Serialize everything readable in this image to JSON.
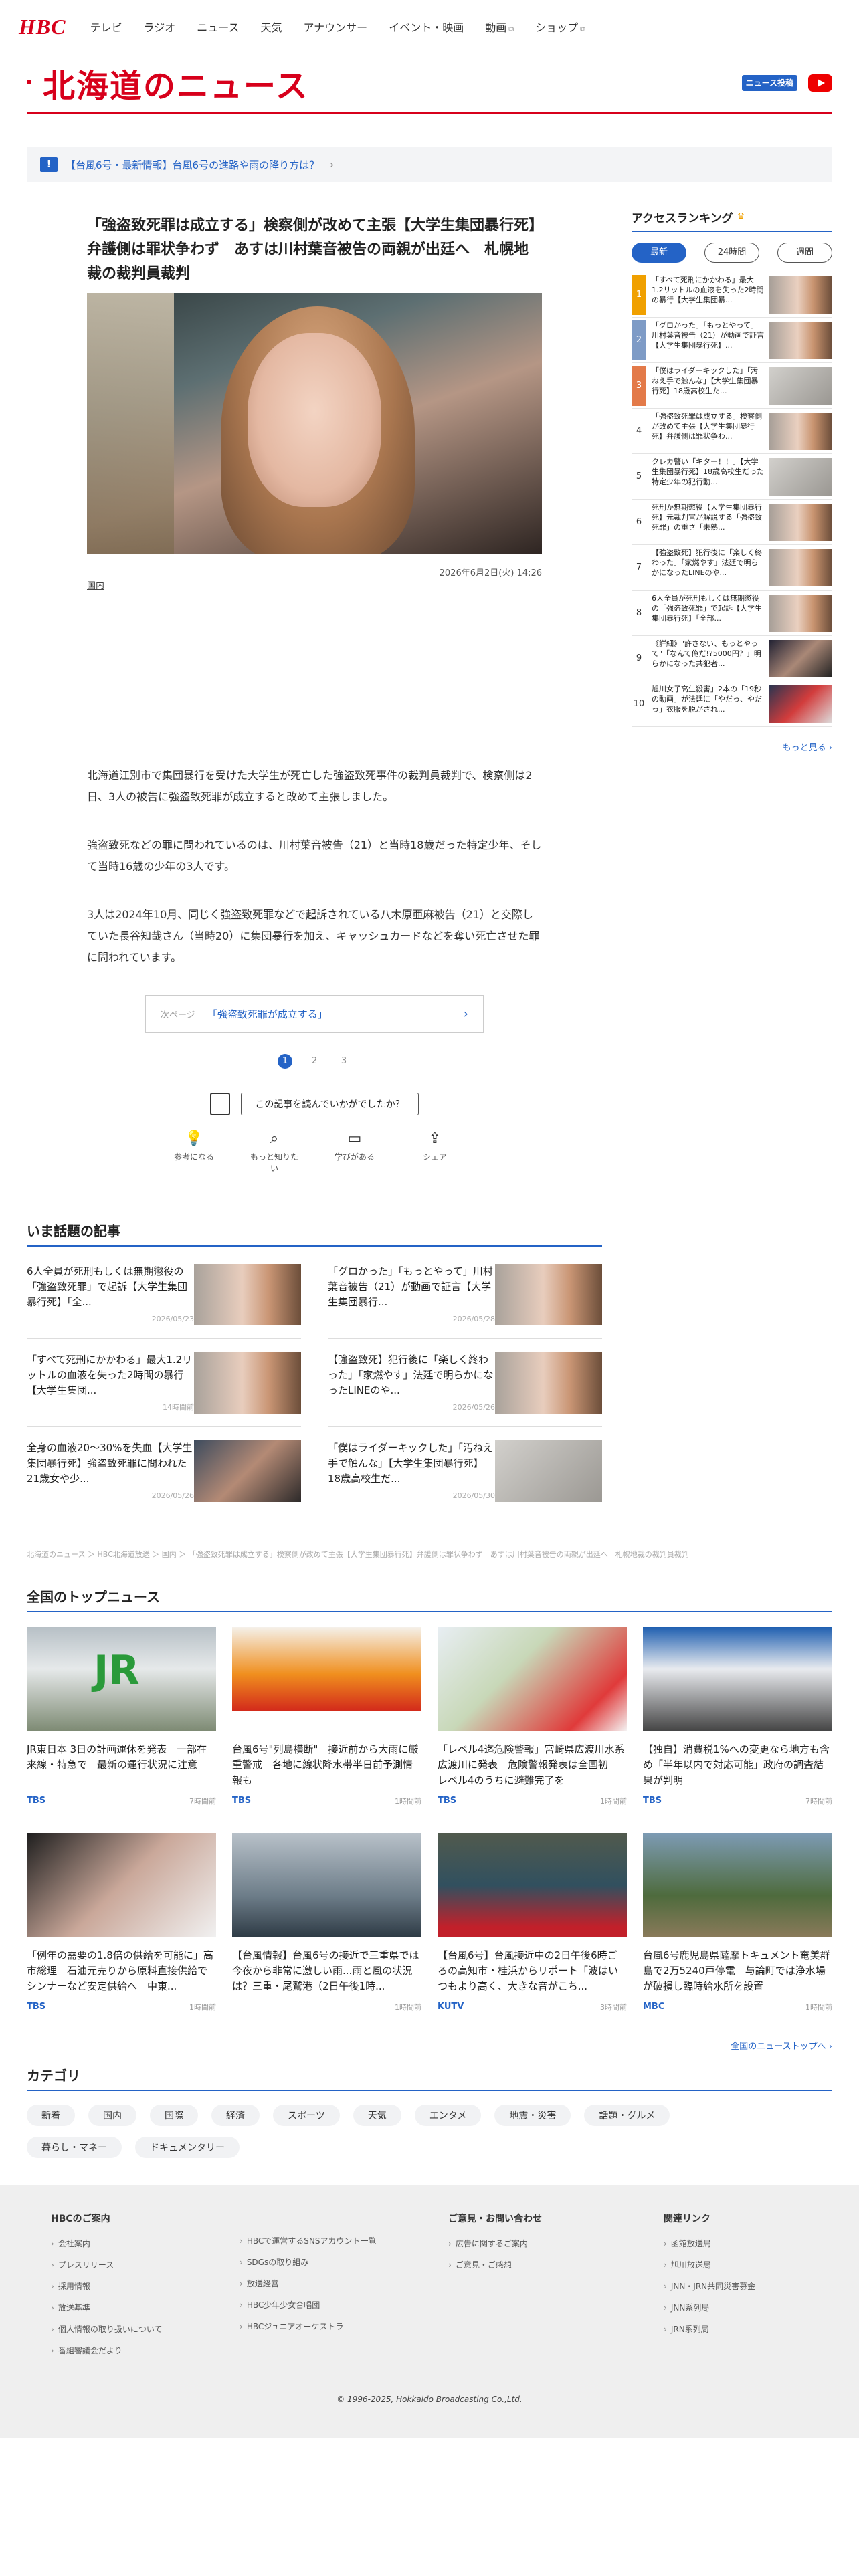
{
  "nav": {
    "logo": "HBC",
    "items": [
      "テレビ",
      "ラジオ",
      "ニュース",
      "天気",
      "アナウンサー",
      "イベント・映画",
      "動画",
      "ショップ"
    ]
  },
  "header": {
    "title": "北海道のニュース",
    "news_post": "ニュース投稿"
  },
  "alert": {
    "icon": "!",
    "text": "【台風6号・最新情報】台風6号の進路や雨の降り方は？"
  },
  "article": {
    "title": "「強盗致死罪は成立する」検察側が改めて主張【大学生集団暴行死】弁護側は罪状争わず　あすは川村葉音被告の両親が出廷へ　札幌地裁の裁判員裁判",
    "date": "2026年6月2日(火) 14:26",
    "category": "国内",
    "paragraphs": [
      "北海道江別市で集団暴行を受けた大学生が死亡した強盗致死事件の裁判員裁判で、検察側は2日、3人の被告に強盗致死罪が成立すると改めて主張しました。",
      "強盗致死などの罪に問われているのは、川村葉音被告（21）と当時18歳だった特定少年、そして当時16歳の少年の3人です。",
      "3人は2024年10月、同じく強盗致死罪などで起訴されている八木原亜麻被告（21）と交際していた長谷知哉さん（当時20）に集団暴行を加え、キャッシュカードなどを奪い死亡させた罪に問われています。"
    ],
    "next_label": "次ページ",
    "next_title": "「強盗致死罪が成立する」",
    "pages": [
      "1",
      "2",
      "3"
    ],
    "feedback_q": "この記事を読んでいかがでしたか？",
    "reactions": [
      "参考になる",
      "もっと知りたい",
      "学びがある",
      "シェア"
    ]
  },
  "ranking": {
    "title": "アクセスランキング",
    "tabs": [
      "最新",
      "24時間",
      "週間"
    ],
    "items": [
      "「すべて死刑にかかわる」最大1.2リットルの血液を失った2時間の暴行【大学生集団暴...",
      "「グロかった」「もっとやって」川村葉音被告（21）が動画で証言【大学生集団暴行死】...",
      "「僕はライダーキックした」「汚ねえ手で触んな」【大学生集団暴行死】18歳高校生た...",
      "「強盗致死罪は成立する」検察側が改めて主張【大学生集団暴行死】弁護側は罪状争わ...",
      "クレカ警い「キター！！」【大学生集団暴行死】18歳高校生だった特定少年の犯行動...",
      "死刑か無期懲役【大学生集団暴行死】元裁判官が解説する「強盗致死罪」の重さ「未熟...",
      "【強盗致死】犯行後に「楽しく終わった」「家燃やす」法廷で明らかになったLINEのや...",
      "6人全員が死刑もしくは無期懲役の「強盗致死罪」で起訴【大学生集団暴行死】「全部...",
      "《詳細》\"許さない、もっとやって\"「なんて俺だ!?5000円？」明らかになった共犯者...",
      "旭川女子高生殺害」2本の「19秒の動画」が法廷に「やだっ、やだっ」衣服を脱がされ..."
    ],
    "more": "もっと見る"
  },
  "trending": {
    "title": "いま話題の記事",
    "items": [
      {
        "text": "6人全員が死刑もしくは無期懲役の「強盗致死罪」で起訴【大学生集団暴行死】「全...",
        "date": "2026/05/23"
      },
      {
        "text": "「グロかった」「もっとやって」川村葉音被告（21）が動画で証言【大学生集団暴行...",
        "date": "2026/05/28"
      },
      {
        "text": "「すべて死刑にかかわる」最大1.2リットルの血液を失った2時間の暴行【大学生集団...",
        "date": "14時間前"
      },
      {
        "text": "【強盗致死】犯行後に「楽しく終わった」「家燃やす」法廷で明らかになったLINEのや...",
        "date": "2026/05/26"
      },
      {
        "text": "全身の血液20～30%を失血【大学生集団暴行死】強盗致死罪に問われた21歳女や少...",
        "date": "2026/05/26"
      },
      {
        "text": "「僕はライダーキックした」「汚ねえ手で触んな」【大学生集団暴行死】18歳高校生だ...",
        "date": "2026/05/30"
      }
    ]
  },
  "breadcrumb": "北海道のニュース ＞ HBC北海道放送 ＞ 国内 ＞ 「強盗致死罪は成立する」検察側が改めて主張【大学生集団暴行死】弁護側は罪状争わず　あすは川村葉音被告の両親が出廷へ　札幌地裁の裁判員裁判",
  "topnews": {
    "title": "全国のトップニュース",
    "items": [
      {
        "text": "JR東日本 3日の計画運休を発表　一部在来線・特急で　最新の運行状況に注意",
        "src": "TBS",
        "time": "7時間前"
      },
      {
        "text": "台風6号\"列島横断\"　接近前から大雨に厳重警戒　各地に線状降水帯半日前予測情報も",
        "src": "TBS",
        "time": "1時間前"
      },
      {
        "text": "「レベル4迄危険警報」宮崎県広渡川水系広渡川に発表　危険警報発表は全国初　レベル4のうちに避難完了を",
        "src": "TBS",
        "time": "1時間前"
      },
      {
        "text": "【独自】消費税1%への変更なら地方も含め「半年以内で対応可能」政府の調査結果が判明",
        "src": "TBS",
        "time": "7時間前"
      },
      {
        "text": "「例年の需要の1.8倍の供給を可能に」高市総理　石油元売りから原料直接供給でシンナーなど安定供給へ　中東...",
        "src": "TBS",
        "time": "1時間前"
      },
      {
        "text": "【台風情報】台風6号の接近で三重県では今夜から非常に激しい雨...雨と風の状況は？三重・尾鷲港（2日午後1時...",
        "src": "",
        "time": "1時間前"
      },
      {
        "text": "【台風6号】台風接近中の2日午後6時ごろの高知市・桂浜からリポート「波はいつもより高く、大きな音がこち...",
        "src": "KUTV",
        "time": "3時間前"
      },
      {
        "text": "台風6号鹿児島県薩摩トキュメント奄美群島で2万5240戸停電　与論町では浄水場が破損し臨時給水所を設置",
        "src": "MBC",
        "time": "1時間前"
      }
    ],
    "all_link": "全国のニューストップへ"
  },
  "category": {
    "title": "カテゴリ",
    "items": [
      "新着",
      "国内",
      "国際",
      "経済",
      "スポーツ",
      "天気",
      "エンタメ",
      "地震・災害",
      "話題・グルメ",
      "暮らし・マネー",
      "ドキュメンタリー"
    ]
  },
  "footer": {
    "col1_title": "HBCのご案内",
    "col1": [
      "会社案内",
      "プレスリリース",
      "採用情報",
      "放送基準",
      "個人情報の取り扱いについて",
      "番組審議会だより"
    ],
    "col2_title": "",
    "col2": [
      "HBCで運営するSNSアカウント一覧",
      "SDGsの取り組み",
      "放送経営",
      "HBC少年少女合唱団",
      "HBCジュニアオーケストラ"
    ],
    "col3_title": "ご意見・お問い合わせ",
    "col3": [
      "広告に関するご案内",
      "ご意見・ご感想"
    ],
    "col4_title": "関連リンク",
    "col4": [
      "函館放送局",
      "旭川放送局",
      "JNN・JRN共同災害募金",
      "JNN系列局",
      "JRN系列局"
    ],
    "copyright": "© 1996-2025, Hokkaido Broadcasting Co.,Ltd."
  }
}
